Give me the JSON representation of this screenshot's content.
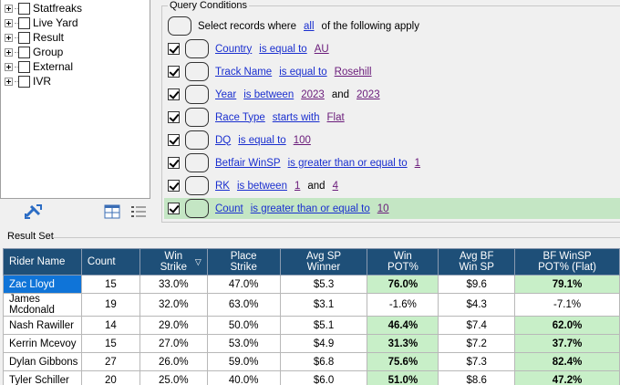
{
  "tree": {
    "items": [
      {
        "label": "Statfreaks"
      },
      {
        "label": "Live Yard"
      },
      {
        "label": "Result"
      },
      {
        "label": "Group"
      },
      {
        "label": "External"
      },
      {
        "label": "IVR"
      }
    ]
  },
  "query": {
    "caption": "Query Conditions",
    "header": {
      "prefix": "Select records where",
      "mode": "all",
      "suffix": "of the following apply"
    },
    "conditions": [
      {
        "field": "Country",
        "op": "is equal to",
        "value": "AU",
        "and_label": "",
        "value2": "",
        "checked": true
      },
      {
        "field": "Track Name",
        "op": "is equal to",
        "value": "Rosehill",
        "and_label": "",
        "value2": "",
        "checked": true
      },
      {
        "field": "Year",
        "op": "is between",
        "value": "2023",
        "and_label": "and",
        "value2": "2023",
        "checked": true
      },
      {
        "field": "Race Type",
        "op": "starts with",
        "value": "Flat",
        "and_label": "",
        "value2": "",
        "checked": true
      },
      {
        "field": "DQ",
        "op": "is equal to",
        "value": "100",
        "and_label": "",
        "value2": "",
        "checked": true
      },
      {
        "field": "Betfair WinSP",
        "op": "is greater than or equal to",
        "value": "1",
        "and_label": "",
        "value2": "",
        "checked": true
      },
      {
        "field": "RK",
        "op": "is between",
        "value": "1",
        "and_label": "and",
        "value2": "4",
        "checked": true
      },
      {
        "field": "Count",
        "op": "is greater than or equal to",
        "value": "10",
        "and_label": "",
        "value2": "",
        "checked": true,
        "selected": true
      }
    ]
  },
  "result": {
    "caption": "Result Set",
    "columns": [
      {
        "l1": "Rider Name",
        "l2": ""
      },
      {
        "l1": "Count",
        "l2": ""
      },
      {
        "l1": "Win",
        "l2": "Strike"
      },
      {
        "l1": "Place",
        "l2": "Strike"
      },
      {
        "l1": "Avg SP",
        "l2": "Winner"
      },
      {
        "l1": "Win",
        "l2": "POT%"
      },
      {
        "l1": "Avg BF",
        "l2": "Win SP"
      },
      {
        "l1": "BF WinSP",
        "l2": "POT% (Flat)"
      }
    ],
    "sort_indicator": "▽",
    "rows": [
      {
        "name": "Zac Lloyd",
        "count": "15",
        "win_strike": "33.0%",
        "place_strike": "47.0%",
        "avg_sp": "$5.3",
        "win_pot": "76.0%",
        "avg_bf": "$9.6",
        "bf_pot": "79.1%",
        "win_pot_hl": true,
        "bf_pot_hl": true,
        "selected": true
      },
      {
        "name": "James Mcdonald",
        "count": "19",
        "win_strike": "32.0%",
        "place_strike": "63.0%",
        "avg_sp": "$3.1",
        "win_pot": "-1.6%",
        "avg_bf": "$4.3",
        "bf_pot": "-7.1%",
        "win_pot_hl": false,
        "bf_pot_hl": false,
        "selected": false
      },
      {
        "name": "Nash Rawiller",
        "count": "14",
        "win_strike": "29.0%",
        "place_strike": "50.0%",
        "avg_sp": "$5.1",
        "win_pot": "46.4%",
        "avg_bf": "$7.4",
        "bf_pot": "62.0%",
        "win_pot_hl": true,
        "bf_pot_hl": true,
        "selected": false
      },
      {
        "name": "Kerrin Mcevoy",
        "count": "15",
        "win_strike": "27.0%",
        "place_strike": "53.0%",
        "avg_sp": "$4.9",
        "win_pot": "31.3%",
        "avg_bf": "$7.2",
        "bf_pot": "37.7%",
        "win_pot_hl": true,
        "bf_pot_hl": true,
        "selected": false
      },
      {
        "name": "Dylan Gibbons",
        "count": "27",
        "win_strike": "26.0%",
        "place_strike": "59.0%",
        "avg_sp": "$6.8",
        "win_pot": "75.6%",
        "avg_bf": "$7.3",
        "bf_pot": "82.4%",
        "win_pot_hl": true,
        "bf_pot_hl": true,
        "selected": false
      },
      {
        "name": "Tyler Schiller",
        "count": "20",
        "win_strike": "25.0%",
        "place_strike": "40.0%",
        "avg_sp": "$6.0",
        "win_pot": "51.0%",
        "avg_bf": "$8.6",
        "bf_pot": "47.2%",
        "win_pot_hl": true,
        "bf_pot_hl": true,
        "selected": false
      }
    ]
  },
  "colors": {
    "header_bg": "#1e4f78",
    "highlight": "#c8efc8",
    "selected_row": "#c4e6c4",
    "link": "#1a2fcf",
    "value_link": "#6a1b7a"
  }
}
